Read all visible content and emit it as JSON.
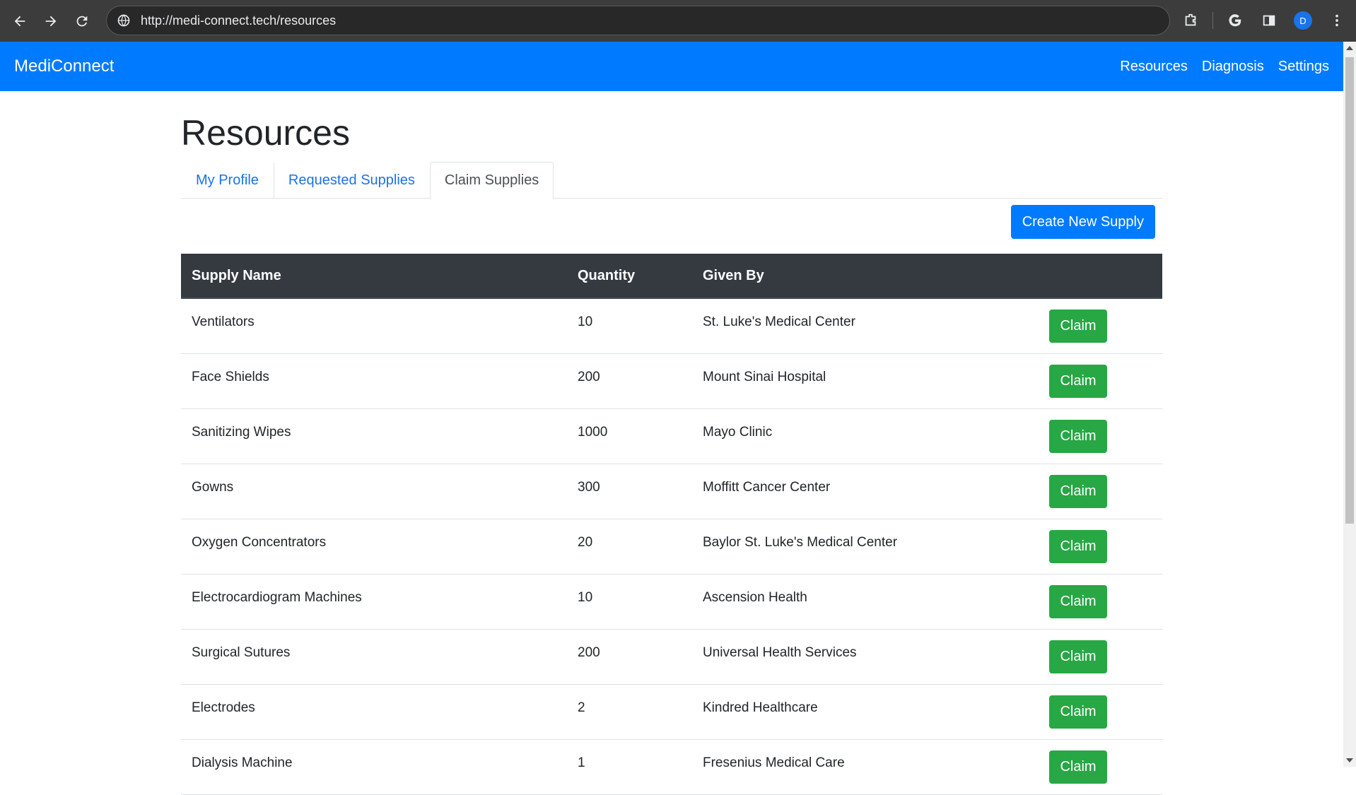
{
  "browser": {
    "url": "http://medi-connect.tech/resources",
    "avatar_letter": "D"
  },
  "navbar": {
    "brand": "MediConnect",
    "links": [
      "Resources",
      "Diagnosis",
      "Settings"
    ]
  },
  "page": {
    "title": "Resources",
    "tabs": [
      "My Profile",
      "Requested Supplies",
      "Claim Supplies"
    ],
    "active_tab": "Claim Supplies",
    "create_button": "Create New Supply"
  },
  "table": {
    "headers": [
      "Supply Name",
      "Quantity",
      "Given By",
      ""
    ],
    "rows": [
      {
        "name": "Ventilators",
        "quantity": "10",
        "given_by": "St. Luke's Medical Center",
        "action": "Claim"
      },
      {
        "name": "Face Shields",
        "quantity": "200",
        "given_by": "Mount Sinai Hospital",
        "action": "Claim"
      },
      {
        "name": "Sanitizing Wipes",
        "quantity": "1000",
        "given_by": "Mayo Clinic",
        "action": "Claim"
      },
      {
        "name": "Gowns",
        "quantity": "300",
        "given_by": "Moffitt Cancer Center",
        "action": "Claim"
      },
      {
        "name": "Oxygen Concentrators",
        "quantity": "20",
        "given_by": "Baylor St. Luke's Medical Center",
        "action": "Claim"
      },
      {
        "name": "Electrocardiogram Machines",
        "quantity": "10",
        "given_by": "Ascension Health",
        "action": "Claim"
      },
      {
        "name": "Surgical Sutures",
        "quantity": "200",
        "given_by": "Universal Health Services",
        "action": "Claim"
      },
      {
        "name": "Electrodes",
        "quantity": "2",
        "given_by": "Kindred Healthcare",
        "action": "Claim"
      },
      {
        "name": "Dialysis Machine",
        "quantity": "1",
        "given_by": "Fresenius Medical Care",
        "action": "Claim"
      }
    ]
  },
  "colors": {
    "primary": "#007bff",
    "success": "#28a745",
    "table_header": "#343a40",
    "chrome": "#3c3c3c"
  },
  "icons": {
    "back": "arrow-left-icon",
    "forward": "arrow-right-icon",
    "reload": "reload-icon",
    "site_info": "site-info-icon",
    "extensions": "puzzle-icon",
    "google": "google-icon",
    "side_panel": "side-panel-icon",
    "menu": "kebab-menu-icon"
  }
}
